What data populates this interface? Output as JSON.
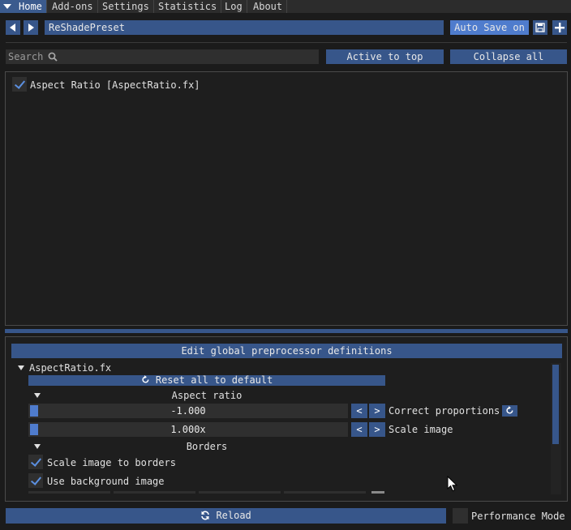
{
  "tabs": [
    {
      "label": "Home",
      "active": true
    },
    {
      "label": "Add-ons",
      "active": false
    },
    {
      "label": "Settings",
      "active": false
    },
    {
      "label": "Statistics",
      "active": false
    },
    {
      "label": "Log",
      "active": false
    },
    {
      "label": "About",
      "active": false
    }
  ],
  "preset": {
    "name": "ReShadePreset",
    "auto_save_label": "Auto Save on"
  },
  "search": {
    "placeholder": "Search",
    "active_to_top_label": "Active to top",
    "collapse_all_label": "Collapse all"
  },
  "effects": [
    {
      "label": "Aspect Ratio [AspectRatio.fx]",
      "enabled": true
    }
  ],
  "params": {
    "edit_preproc_label": "Edit global preprocessor definitions",
    "file_label": "AspectRatio.fx",
    "reset_label": "Reset all to default",
    "group_aspect": "Aspect ratio",
    "correct_proportions": {
      "value": "-1.000",
      "label": "Correct proportions",
      "dec": "<",
      "inc": ">"
    },
    "scale_image": {
      "value": "1.000x",
      "label": "Scale image",
      "dec": "<",
      "inc": ">"
    },
    "group_borders": "Borders",
    "scale_to_borders": {
      "label": "Scale image to borders",
      "checked": true
    },
    "use_bg_image": {
      "label": "Use background image",
      "checked": true
    }
  },
  "footer": {
    "reload_label": "Reload",
    "performance_mode_label": "Performance Mode",
    "performance_mode": false
  },
  "colors": {
    "accent": "#37568a",
    "accent_light": "#4f7ccd",
    "background": "#1b1b1b",
    "check": "#5b8fe0"
  }
}
